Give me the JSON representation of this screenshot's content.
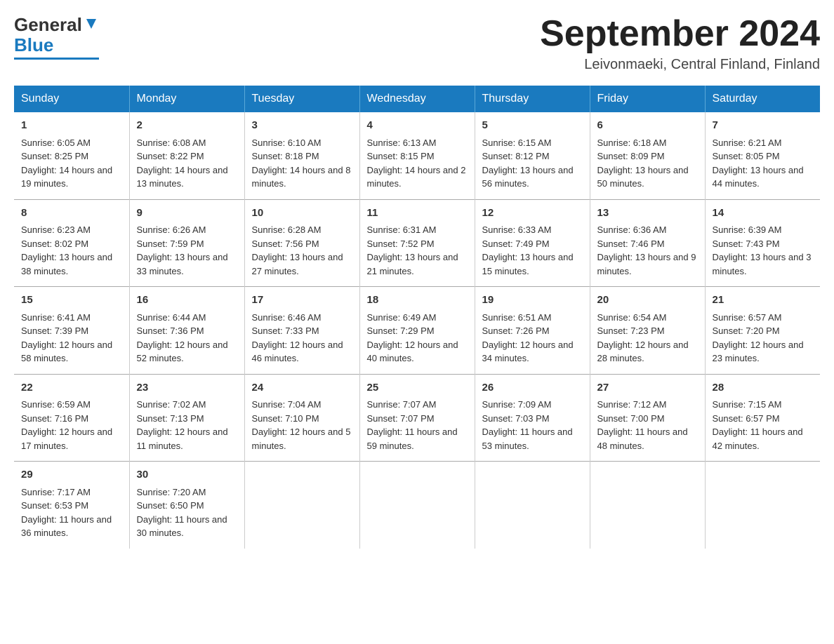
{
  "header": {
    "logo_general": "General",
    "logo_blue": "Blue",
    "title": "September 2024",
    "location": "Leivonmaeki, Central Finland, Finland"
  },
  "weekdays": [
    "Sunday",
    "Monday",
    "Tuesday",
    "Wednesday",
    "Thursday",
    "Friday",
    "Saturday"
  ],
  "weeks": [
    [
      {
        "day": "1",
        "sunrise": "Sunrise: 6:05 AM",
        "sunset": "Sunset: 8:25 PM",
        "daylight": "Daylight: 14 hours and 19 minutes."
      },
      {
        "day": "2",
        "sunrise": "Sunrise: 6:08 AM",
        "sunset": "Sunset: 8:22 PM",
        "daylight": "Daylight: 14 hours and 13 minutes."
      },
      {
        "day": "3",
        "sunrise": "Sunrise: 6:10 AM",
        "sunset": "Sunset: 8:18 PM",
        "daylight": "Daylight: 14 hours and 8 minutes."
      },
      {
        "day": "4",
        "sunrise": "Sunrise: 6:13 AM",
        "sunset": "Sunset: 8:15 PM",
        "daylight": "Daylight: 14 hours and 2 minutes."
      },
      {
        "day": "5",
        "sunrise": "Sunrise: 6:15 AM",
        "sunset": "Sunset: 8:12 PM",
        "daylight": "Daylight: 13 hours and 56 minutes."
      },
      {
        "day": "6",
        "sunrise": "Sunrise: 6:18 AM",
        "sunset": "Sunset: 8:09 PM",
        "daylight": "Daylight: 13 hours and 50 minutes."
      },
      {
        "day": "7",
        "sunrise": "Sunrise: 6:21 AM",
        "sunset": "Sunset: 8:05 PM",
        "daylight": "Daylight: 13 hours and 44 minutes."
      }
    ],
    [
      {
        "day": "8",
        "sunrise": "Sunrise: 6:23 AM",
        "sunset": "Sunset: 8:02 PM",
        "daylight": "Daylight: 13 hours and 38 minutes."
      },
      {
        "day": "9",
        "sunrise": "Sunrise: 6:26 AM",
        "sunset": "Sunset: 7:59 PM",
        "daylight": "Daylight: 13 hours and 33 minutes."
      },
      {
        "day": "10",
        "sunrise": "Sunrise: 6:28 AM",
        "sunset": "Sunset: 7:56 PM",
        "daylight": "Daylight: 13 hours and 27 minutes."
      },
      {
        "day": "11",
        "sunrise": "Sunrise: 6:31 AM",
        "sunset": "Sunset: 7:52 PM",
        "daylight": "Daylight: 13 hours and 21 minutes."
      },
      {
        "day": "12",
        "sunrise": "Sunrise: 6:33 AM",
        "sunset": "Sunset: 7:49 PM",
        "daylight": "Daylight: 13 hours and 15 minutes."
      },
      {
        "day": "13",
        "sunrise": "Sunrise: 6:36 AM",
        "sunset": "Sunset: 7:46 PM",
        "daylight": "Daylight: 13 hours and 9 minutes."
      },
      {
        "day": "14",
        "sunrise": "Sunrise: 6:39 AM",
        "sunset": "Sunset: 7:43 PM",
        "daylight": "Daylight: 13 hours and 3 minutes."
      }
    ],
    [
      {
        "day": "15",
        "sunrise": "Sunrise: 6:41 AM",
        "sunset": "Sunset: 7:39 PM",
        "daylight": "Daylight: 12 hours and 58 minutes."
      },
      {
        "day": "16",
        "sunrise": "Sunrise: 6:44 AM",
        "sunset": "Sunset: 7:36 PM",
        "daylight": "Daylight: 12 hours and 52 minutes."
      },
      {
        "day": "17",
        "sunrise": "Sunrise: 6:46 AM",
        "sunset": "Sunset: 7:33 PM",
        "daylight": "Daylight: 12 hours and 46 minutes."
      },
      {
        "day": "18",
        "sunrise": "Sunrise: 6:49 AM",
        "sunset": "Sunset: 7:29 PM",
        "daylight": "Daylight: 12 hours and 40 minutes."
      },
      {
        "day": "19",
        "sunrise": "Sunrise: 6:51 AM",
        "sunset": "Sunset: 7:26 PM",
        "daylight": "Daylight: 12 hours and 34 minutes."
      },
      {
        "day": "20",
        "sunrise": "Sunrise: 6:54 AM",
        "sunset": "Sunset: 7:23 PM",
        "daylight": "Daylight: 12 hours and 28 minutes."
      },
      {
        "day": "21",
        "sunrise": "Sunrise: 6:57 AM",
        "sunset": "Sunset: 7:20 PM",
        "daylight": "Daylight: 12 hours and 23 minutes."
      }
    ],
    [
      {
        "day": "22",
        "sunrise": "Sunrise: 6:59 AM",
        "sunset": "Sunset: 7:16 PM",
        "daylight": "Daylight: 12 hours and 17 minutes."
      },
      {
        "day": "23",
        "sunrise": "Sunrise: 7:02 AM",
        "sunset": "Sunset: 7:13 PM",
        "daylight": "Daylight: 12 hours and 11 minutes."
      },
      {
        "day": "24",
        "sunrise": "Sunrise: 7:04 AM",
        "sunset": "Sunset: 7:10 PM",
        "daylight": "Daylight: 12 hours and 5 minutes."
      },
      {
        "day": "25",
        "sunrise": "Sunrise: 7:07 AM",
        "sunset": "Sunset: 7:07 PM",
        "daylight": "Daylight: 11 hours and 59 minutes."
      },
      {
        "day": "26",
        "sunrise": "Sunrise: 7:09 AM",
        "sunset": "Sunset: 7:03 PM",
        "daylight": "Daylight: 11 hours and 53 minutes."
      },
      {
        "day": "27",
        "sunrise": "Sunrise: 7:12 AM",
        "sunset": "Sunset: 7:00 PM",
        "daylight": "Daylight: 11 hours and 48 minutes."
      },
      {
        "day": "28",
        "sunrise": "Sunrise: 7:15 AM",
        "sunset": "Sunset: 6:57 PM",
        "daylight": "Daylight: 11 hours and 42 minutes."
      }
    ],
    [
      {
        "day": "29",
        "sunrise": "Sunrise: 7:17 AM",
        "sunset": "Sunset: 6:53 PM",
        "daylight": "Daylight: 11 hours and 36 minutes."
      },
      {
        "day": "30",
        "sunrise": "Sunrise: 7:20 AM",
        "sunset": "Sunset: 6:50 PM",
        "daylight": "Daylight: 11 hours and 30 minutes."
      },
      null,
      null,
      null,
      null,
      null
    ]
  ]
}
